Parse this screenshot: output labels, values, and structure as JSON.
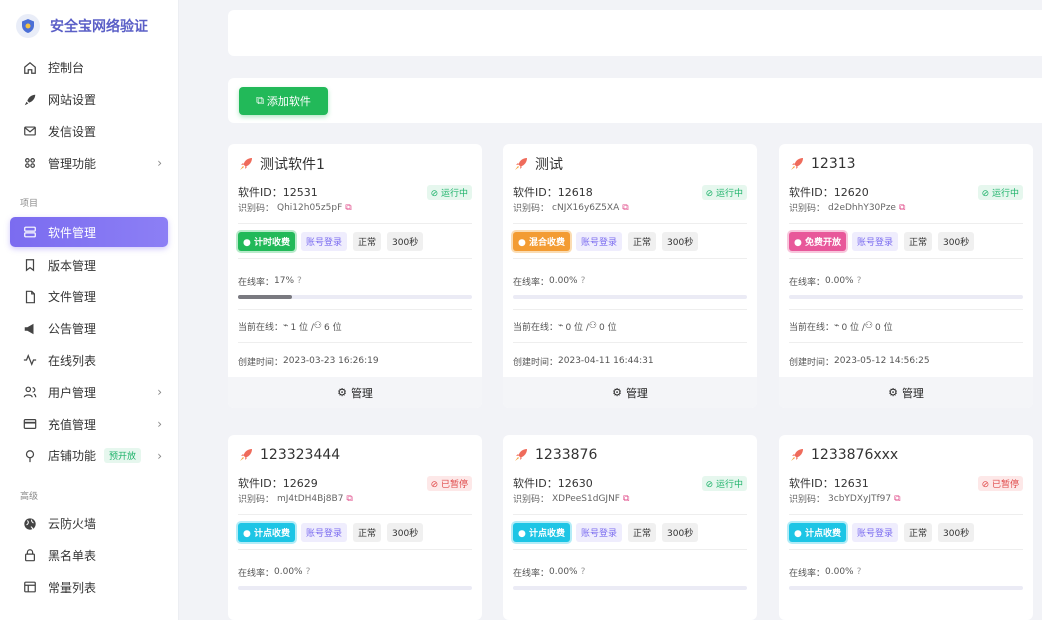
{
  "app": {
    "title": "安全宝网络验证"
  },
  "sidebar": {
    "top_items": [
      {
        "label": "控制台",
        "icon": "home-icon"
      },
      {
        "label": "网站设置",
        "icon": "rocket-icon"
      },
      {
        "label": "发信设置",
        "icon": "mail-icon"
      },
      {
        "label": "管理功能",
        "icon": "grid-icon",
        "chevron": "›"
      }
    ],
    "section_project": "项目",
    "project_items": [
      {
        "label": "软件管理",
        "icon": "server-icon",
        "active": true
      },
      {
        "label": "版本管理",
        "icon": "bookmark-icon"
      },
      {
        "label": "文件管理",
        "icon": "file-icon"
      },
      {
        "label": "公告管理",
        "icon": "megaphone-icon"
      },
      {
        "label": "在线列表",
        "icon": "activity-icon"
      },
      {
        "label": "用户管理",
        "icon": "users-icon",
        "chevron": "›"
      },
      {
        "label": "充值管理",
        "icon": "card-icon",
        "chevron": "›"
      },
      {
        "label": "店铺功能",
        "icon": "pin-icon",
        "chevron": "›",
        "badge": "预开放"
      }
    ],
    "section_advanced": "高级",
    "advanced_items": [
      {
        "label": "云防火墙",
        "icon": "globe-icon"
      },
      {
        "label": "黑名单表",
        "icon": "lock-icon"
      },
      {
        "label": "常量列表",
        "icon": "table-icon"
      }
    ]
  },
  "toolbar": {
    "add_label": "添加软件"
  },
  "labels": {
    "id_prefix": "软件ID：",
    "code_prefix": "识别码：",
    "online_rate": "在线率：",
    "online_now": "当前在线：",
    "created": "创建时间：",
    "manage": "管理"
  },
  "cards": [
    {
      "name": "测试软件1",
      "id": "12531",
      "code": "Qhi12h05z5pF",
      "status": "运行中",
      "status_type": "run",
      "mode": "计时收费",
      "mode_type": "timed",
      "login": "账号登录",
      "state": "正常",
      "interval": "300秒",
      "rate": "17%",
      "rate_value": 0.17,
      "online": "1 位 / ",
      "total": "6 位",
      "created": "2023-03-23 16:26:19"
    },
    {
      "name": "测试",
      "id": "12618",
      "code": "cNJX16y6Z5XA",
      "status": "运行中",
      "status_type": "run",
      "mode": "混合收费",
      "mode_type": "mixed",
      "login": "账号登录",
      "state": "正常",
      "interval": "300秒",
      "rate": "0.00%",
      "rate_value": 0,
      "online": "0 位 / ",
      "total": "0 位",
      "created": "2023-04-11 16:44:31"
    },
    {
      "name": "12313",
      "id": "12620",
      "code": "d2eDhhY30Pze",
      "status": "运行中",
      "status_type": "run",
      "mode": "免费开放",
      "mode_type": "free",
      "login": "账号登录",
      "state": "正常",
      "interval": "300秒",
      "rate": "0.00%",
      "rate_value": 0,
      "online": "0 位 / ",
      "total": "0 位",
      "created": "2023-05-12 14:56:25"
    },
    {
      "name": "123323444",
      "id": "12629",
      "code": "mJ4tDH4Bj8B7",
      "status": "已暂停",
      "status_type": "stop",
      "mode": "计点收费",
      "mode_type": "point",
      "login": "账号登录",
      "state": "正常",
      "interval": "300秒",
      "rate": "0.00%",
      "rate_value": 0
    },
    {
      "name": "1233876",
      "id": "12630",
      "code": "XDPeeS1dGJNF",
      "status": "运行中",
      "status_type": "run",
      "mode": "计点收费",
      "mode_type": "point",
      "login": "账号登录",
      "state": "正常",
      "interval": "300秒",
      "rate": "0.00%",
      "rate_value": 0
    },
    {
      "name": "1233876xxx",
      "id": "12631",
      "code": "3cbYDXyJTf97",
      "status": "已暂停",
      "status_type": "stop",
      "mode": "计点收费",
      "mode_type": "point",
      "login": "账号登录",
      "state": "正常",
      "interval": "300秒",
      "rate": "0.00%",
      "rate_value": 0
    }
  ]
}
